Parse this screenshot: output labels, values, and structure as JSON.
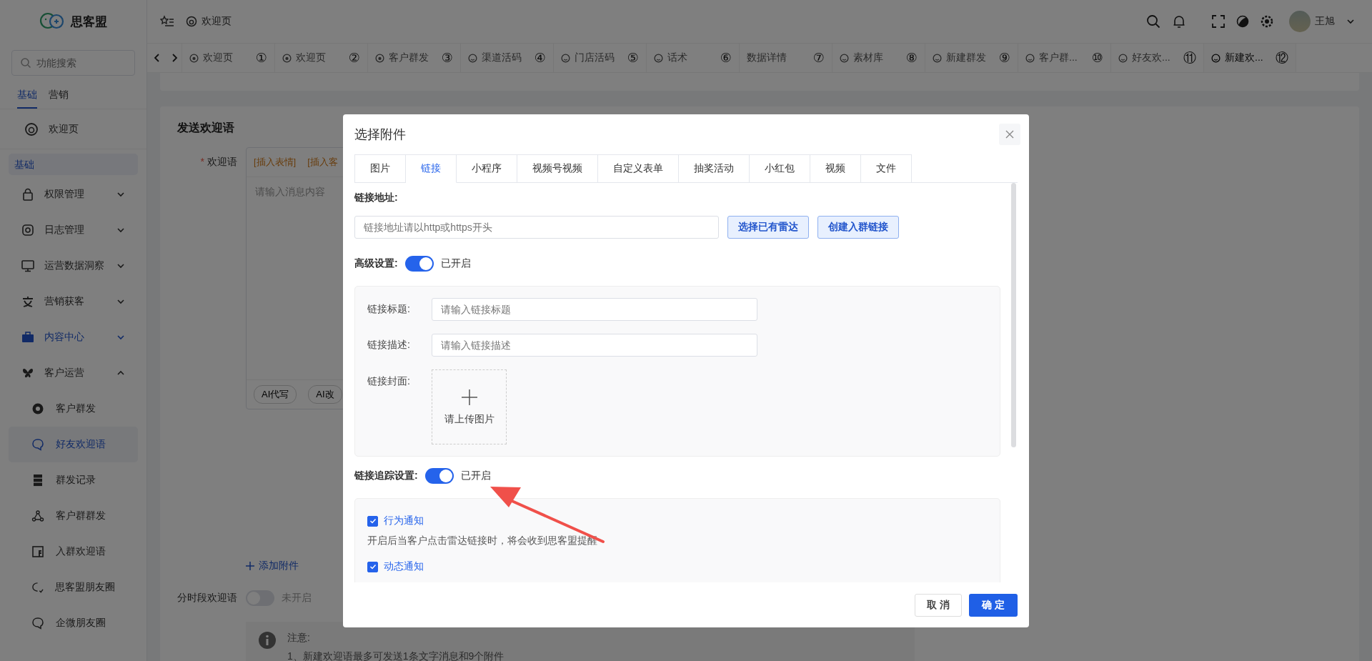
{
  "sidebar": {
    "logo": "思客盟",
    "search": {
      "placeholder": "功能搜索"
    },
    "tabs": [
      {
        "label": "基础",
        "selected": true
      },
      {
        "label": "营销",
        "selected": false
      }
    ],
    "home": "欢迎页",
    "group": "基础",
    "items": [
      {
        "label": "权限管理",
        "active": false,
        "expanded": false
      },
      {
        "label": "日志管理",
        "active": false,
        "expanded": false
      },
      {
        "label": "运营数据洞察",
        "active": false,
        "expanded": false
      },
      {
        "label": "营销获客",
        "active": false,
        "expanded": false
      },
      {
        "label": "内容中心",
        "active": true,
        "expanded": false
      },
      {
        "label": "客户运营",
        "active": false,
        "expanded": true,
        "children": [
          {
            "label": "客户群发",
            "selected": false
          },
          {
            "label": "好友欢迎语",
            "selected": true
          },
          {
            "label": "群发记录",
            "selected": false
          },
          {
            "label": "客户群群发",
            "selected": false
          },
          {
            "label": "入群欢迎语",
            "selected": false
          },
          {
            "label": "思客盟朋友圈",
            "selected": false
          },
          {
            "label": "企微朋友圈",
            "selected": false
          }
        ]
      }
    ]
  },
  "header": {
    "breadcrumb": "欢迎页",
    "user": "王旭"
  },
  "page_tabs": [
    {
      "label": "欢迎页",
      "number": "①",
      "selected": false
    },
    {
      "label": "欢迎页",
      "number": "②",
      "selected": false
    },
    {
      "label": "客户群发",
      "number": "③",
      "selected": false
    },
    {
      "label": "渠道活码",
      "number": "④",
      "selected": false
    },
    {
      "label": "门店活码",
      "number": "⑤",
      "selected": false
    },
    {
      "label": "话术",
      "number": "⑥",
      "selected": false
    },
    {
      "label": "数据详情",
      "number": "⑦",
      "selected": false
    },
    {
      "label": "素材库",
      "number": "⑧",
      "selected": false
    },
    {
      "label": "新建群发",
      "number": "⑨",
      "selected": false
    },
    {
      "label": "客户群...",
      "number": "⑩",
      "selected": false
    },
    {
      "label": "好友欢...",
      "number": "⑪",
      "selected": false
    },
    {
      "label": "新建欢...",
      "number": "⑫",
      "selected": true
    }
  ],
  "form": {
    "title": "发送欢迎语",
    "welcome_label": "欢迎语",
    "required_mark": "*",
    "toolbar": [
      "[插入表情]",
      "[插入客"
    ],
    "placeholder": "请输入消息内容",
    "ai_buttons": [
      "AI代写",
      "AI改"
    ],
    "add_attachment": "添加附件",
    "timed": {
      "label": "分时段欢迎语",
      "on": false,
      "status": "未开启"
    },
    "notice": {
      "title": "注意:",
      "lines": [
        "1、新建欢迎语最多可发送1条文字消息和9个附件"
      ]
    }
  },
  "dialog": {
    "title": "选择附件",
    "tabs": [
      {
        "label": "图片",
        "selected": false
      },
      {
        "label": "链接",
        "selected": true
      },
      {
        "label": "小程序",
        "selected": false
      },
      {
        "label": "视频号视频",
        "selected": false
      },
      {
        "label": "自定义表单",
        "selected": false
      },
      {
        "label": "抽奖活动",
        "selected": false
      },
      {
        "label": "小红包",
        "selected": false
      },
      {
        "label": "视频",
        "selected": false
      },
      {
        "label": "文件",
        "selected": false
      }
    ],
    "link_address": {
      "label": "链接地址:",
      "placeholder": "链接地址请以http或https开头",
      "buttons": [
        "选择已有雷达",
        "创建入群链接"
      ]
    },
    "advanced": {
      "label": "高级设置:",
      "on": true,
      "status": "已开启",
      "fields": [
        {
          "label": "链接标题:",
          "placeholder": "请输入链接标题"
        },
        {
          "label": "链接描述:",
          "placeholder": "请输入链接描述"
        }
      ],
      "cover": {
        "label": "链接封面:",
        "hint": "请上传图片"
      }
    },
    "tracking": {
      "label": "链接追踪设置:",
      "on": true,
      "status": "已开启",
      "options": [
        {
          "label": "行为通知",
          "checked": true,
          "description": "开启后当客户点击雷达链接时，将会收到思客盟提醒"
        },
        {
          "label": "动态通知",
          "checked": true
        }
      ]
    },
    "cancel": "取 消",
    "ok": "确 定"
  }
}
